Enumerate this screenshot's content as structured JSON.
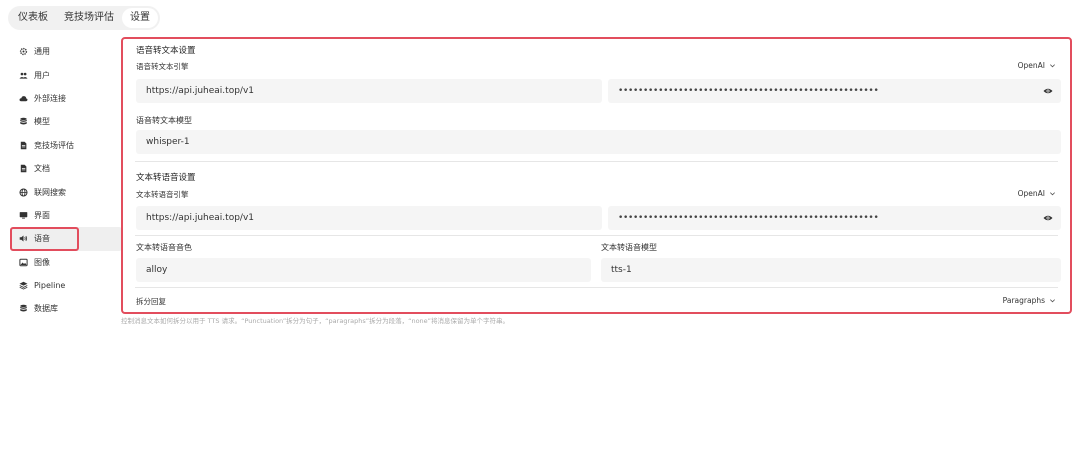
{
  "tabs": [
    {
      "label": "仪表板"
    },
    {
      "label": "竞技场评估"
    },
    {
      "label": "设置"
    }
  ],
  "sidebar": {
    "items": [
      {
        "label": "通用",
        "icon": "gear-icon"
      },
      {
        "label": "用户",
        "icon": "users-icon"
      },
      {
        "label": "外部连接",
        "icon": "cloud-icon"
      },
      {
        "label": "模型",
        "icon": "database-icon"
      },
      {
        "label": "竞技场评估",
        "icon": "document-icon"
      },
      {
        "label": "文档",
        "icon": "document-icon"
      },
      {
        "label": "联网搜索",
        "icon": "globe-icon"
      },
      {
        "label": "界面",
        "icon": "monitor-icon"
      },
      {
        "label": "语音",
        "icon": "speaker-icon"
      },
      {
        "label": "图像",
        "icon": "image-icon"
      },
      {
        "label": "Pipeline",
        "icon": "layers-icon"
      },
      {
        "label": "数据库",
        "icon": "database-icon"
      }
    ]
  },
  "stt": {
    "section_title": "语音转文本设置",
    "engine_label": "语音转文本引擎",
    "engine_value": "OpenAI",
    "api_url": "https://api.juheai.top/v1",
    "api_key_masked": "••••••••••••••••••••••••••••••••••••••••••••••••••••",
    "model_label": "语音转文本模型",
    "model_value": "whisper-1"
  },
  "tts": {
    "section_title": "文本转语音设置",
    "engine_label": "文本转语音引擎",
    "engine_value": "OpenAI",
    "api_url": "https://api.juheai.top/v1",
    "api_key_masked": "••••••••••••••••••••••••••••••••••••••••••••••••••••",
    "voice_label": "文本转语音音色",
    "voice_value": "alloy",
    "model_label": "文本转语音模型",
    "model_value": "tts-1"
  },
  "split": {
    "label": "拆分回复",
    "value": "Paragraphs",
    "help": "控制消息文本如何拆分以用于 TTS 请求。“Punctuation”拆分为句子，“paragraphs”拆分为段落，“none”将消息保留为单个字符串。"
  },
  "colors": {
    "highlight": "#e24d5d",
    "field_bg": "#f5f5f5",
    "active_bg": "#efefef"
  }
}
